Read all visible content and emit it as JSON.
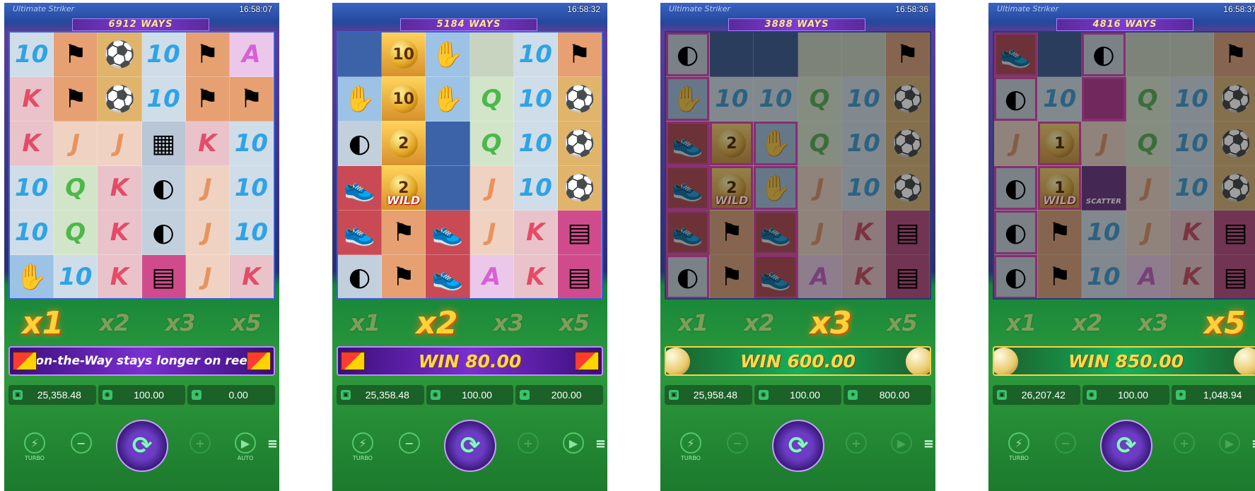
{
  "screens": [
    {
      "brand": "Ultimate Striker",
      "time": "16:58:07",
      "ways": "6912 WAYS",
      "reels": [
        [
          "10",
          "pic:flag",
          "pic:ball",
          "10",
          "pic:flag",
          "A"
        ],
        [
          "K",
          "pic:flag",
          "pic:ball",
          "10",
          "pic:flag",
          "pic:flag"
        ],
        [
          "K",
          "J",
          "J",
          "pic:grid",
          "K",
          "10"
        ],
        [
          "10",
          "Q",
          "K",
          "pic:whistle",
          "J",
          "10"
        ],
        [
          "10",
          "Q",
          "K",
          "pic:whistle",
          "J",
          "10"
        ],
        [
          "pic:glove",
          "10",
          "K",
          "pic:ticket",
          "J",
          "K"
        ]
      ],
      "multipliers": [
        "x1",
        "x2",
        "x3",
        "x5"
      ],
      "active_multiplier": 0,
      "banner_type": "message",
      "banner_text": "is-on-the-Way stays longer on reels!",
      "balance": "25,358.48",
      "bet": "100.00",
      "win": "0.00",
      "controls": {
        "turbo": "TURBO",
        "auto": "AUTO"
      }
    },
    {
      "brand": "",
      "time": "16:58:32",
      "ways": "5184 WAYS",
      "reels": [
        [
          "pic:blue",
          "wild:10",
          "pic:glove",
          "pic:pale",
          "10",
          "pic:flag"
        ],
        [
          "pic:glove",
          "wild:10",
          "pic:glove",
          "Q",
          "10",
          "pic:ball"
        ],
        [
          "pic:whistle",
          "wild:2",
          "pic:blue",
          "Q",
          "10",
          "pic:ball"
        ],
        [
          "pic:boot",
          "wild:2",
          "pic:blue",
          "J",
          "10",
          "pic:ball"
        ],
        [
          "pic:boot",
          "pic:flag",
          "pic:boot",
          "J",
          "K",
          "pic:ticket"
        ],
        [
          "pic:whistle",
          "pic:flag",
          "pic:boot",
          "A",
          "K",
          "pic:ticket"
        ]
      ],
      "multipliers": [
        "x1",
        "x2",
        "x3",
        "x5"
      ],
      "active_multiplier": 1,
      "banner_type": "win",
      "win_label": "WIN",
      "win_amount": "80.00",
      "balance": "25,358.48",
      "bet": "100.00",
      "win": "200.00",
      "controls": {
        "turbo": "TURBO",
        "auto": ""
      }
    },
    {
      "brand": "Ultimate Striker",
      "time": "16:58:36",
      "ways": "3888 WAYS",
      "reels": [
        [
          "pic:whistle",
          "pic:blue",
          "pic:blue",
          "pic:pale",
          "pic:pale",
          "pic:flag"
        ],
        [
          "pic:glove",
          "10",
          "10",
          "Q",
          "10",
          "pic:ball"
        ],
        [
          "pic:boot",
          "wild:2",
          "pic:glove",
          "Q",
          "10",
          "pic:ball"
        ],
        [
          "pic:boot",
          "wild:2",
          "pic:glove",
          "J",
          "10",
          "pic:ball"
        ],
        [
          "pic:boot",
          "pic:flag",
          "pic:boot",
          "J",
          "K",
          "pic:ticket"
        ],
        [
          "pic:whistle",
          "pic:flag",
          "pic:boot",
          "A",
          "K",
          "pic:ticket"
        ]
      ],
      "multipliers": [
        "x1",
        "x2",
        "x3",
        "x5"
      ],
      "active_multiplier": 2,
      "banner_type": "bigwin",
      "win_label": "WIN",
      "win_amount": "600.00",
      "balance": "25,958.48",
      "bet": "100.00",
      "win": "800.00",
      "controls": {
        "turbo": "TURBO",
        "auto": ""
      }
    },
    {
      "brand": "Ultimate Striker",
      "time": "16:58:37",
      "ways": "4816 WAYS",
      "reels": [
        [
          "pic:boot",
          "pic:blue",
          "pic:whistle",
          "pic:pale",
          "pic:pale",
          "pic:flag"
        ],
        [
          "pic:whistle",
          "10",
          "pic:pink",
          "Q",
          "10",
          "pic:ball"
        ],
        [
          "J",
          "wild:1",
          "J",
          "Q",
          "10",
          "pic:ball"
        ],
        [
          "pic:whistle",
          "wild:1",
          "scatter",
          "J",
          "10",
          "pic:ball"
        ],
        [
          "pic:whistle",
          "pic:flag",
          "10",
          "J",
          "K",
          "pic:ticket"
        ],
        [
          "pic:whistle",
          "pic:flag",
          "10",
          "A",
          "K",
          "pic:ticket"
        ]
      ],
      "multipliers": [
        "x1",
        "x2",
        "x3",
        "x5"
      ],
      "active_multiplier": 3,
      "banner_type": "bigwin",
      "win_label": "WIN",
      "win_amount": "850.00",
      "balance": "26,207.42",
      "bet": "100.00",
      "win": "1,048.94",
      "controls": {
        "turbo": "TURBO",
        "auto": ""
      }
    }
  ],
  "wild_label": "WILD",
  "scatter_label": "SCATTER",
  "icons": {
    "balance": "wallet-icon",
    "bet": "coin-icon",
    "win": "win-icon",
    "turbo": "lightning-icon",
    "spin": "spin-arrows-icon"
  },
  "colors": {
    "ten": "#2fa3e6",
    "king": "#e34c68",
    "jack": "#e8935e",
    "queen": "#4cb84a",
    "ace": "#d85fd6",
    "highlight": "#ff3cd2",
    "gold": "#ffd23a"
  }
}
